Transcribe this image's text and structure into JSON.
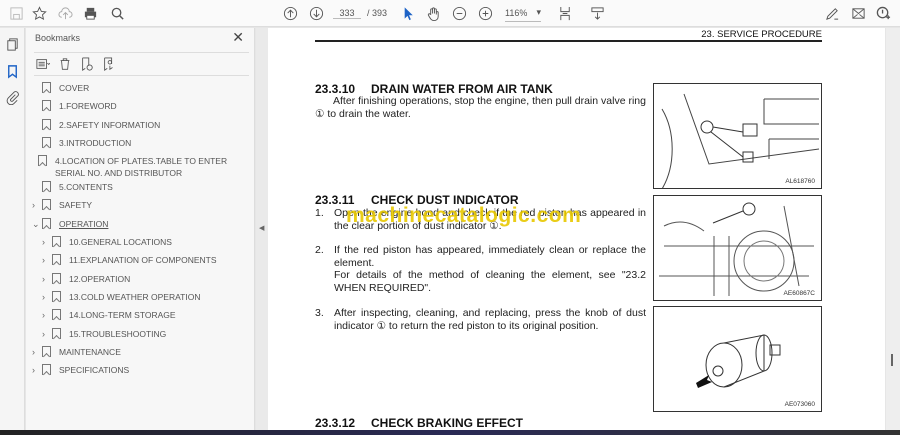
{
  "toolbar": {
    "page_current": "333",
    "page_total": "/ 393",
    "zoom": "116%",
    "zoom_caret": "▾"
  },
  "bookmarks": {
    "title": "Bookmarks",
    "close": "✕",
    "items": [
      {
        "label": "COVER"
      },
      {
        "label": "1.FOREWORD"
      },
      {
        "label": "2.SAFETY INFORMATION"
      },
      {
        "label": "3.INTRODUCTION"
      },
      {
        "label": "4.LOCATION OF PLATES.TABLE TO ENTER SERIAL NO. AND DISTRIBUTOR"
      },
      {
        "label": "5.CONTENTS"
      },
      {
        "label": "SAFETY",
        "chev": "›"
      },
      {
        "label": "OPERATION",
        "chev": "⌄"
      },
      {
        "label": "10.GENERAL LOCATIONS",
        "chev": "›"
      },
      {
        "label": "11.EXPLANATION OF COMPONENTS",
        "chev": "›"
      },
      {
        "label": "12.OPERATION",
        "chev": "›"
      },
      {
        "label": "13.COLD WEATHER OPERATION",
        "chev": "›"
      },
      {
        "label": "14.LONG-TERM STORAGE",
        "chev": "›"
      },
      {
        "label": "15.TROUBLESHOOTING",
        "chev": "›"
      },
      {
        "label": "MAINTENANCE",
        "chev": "›"
      },
      {
        "label": "SPECIFICATIONS",
        "chev": "›"
      }
    ]
  },
  "document": {
    "header": "23.  SERVICE PROCEDURE",
    "s1": {
      "num": "23.3.10",
      "title": "DRAIN WATER FROM AIR TANK",
      "body": "After finishing operations, stop the engine, then pull drain valve ring ① to drain the water."
    },
    "s2": {
      "num": "23.3.11",
      "title": "CHECK DUST INDICATOR",
      "steps": [
        {
          "n": "1.",
          "text": "Open the engine hood and check if the red piston has appeared in the clear portion of dust indicator ①."
        },
        {
          "n": "2.",
          "text": "If the red piston has appeared, immediately clean or replace the element."
        },
        {
          "n": "",
          "text": "For details of the method of cleaning the element, see \"23.2 WHEN REQUIRED\"."
        },
        {
          "n": "3.",
          "text": "After inspecting, cleaning, and replacing, press the knob of dust indicator ① to return the red piston to its original position."
        }
      ]
    },
    "s3": {
      "num": "23.3.12",
      "title": "CHECK BRAKING EFFECT"
    },
    "figures": [
      {
        "caption": "AL618760",
        "callout": "1"
      },
      {
        "caption": "AE60867C",
        "callout": "1"
      },
      {
        "caption": "AE073060"
      }
    ],
    "watermark": "machinecatalogic.com"
  }
}
